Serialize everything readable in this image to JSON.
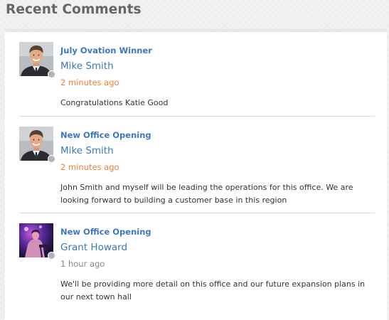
{
  "widget": {
    "title": "Recent Comments"
  },
  "colors": {
    "link": "#3d78c0",
    "recent_time": "#ef7f33",
    "old_time": "#888888",
    "status_dot": "#b3b3b3"
  },
  "comments": [
    {
      "subject": "July Ovation Winner",
      "author": "Mike Smith",
      "time": "2 minutes ago",
      "body": "Congratulations Katie Good",
      "avatar_icon": "user-avatar-mike-smith",
      "status": "offline"
    },
    {
      "subject": "New Office Opening",
      "author": "Mike Smith",
      "time": "2 minutes ago",
      "body": "John Smith and myself will be leading the operations for this office. We are looking forward to building a customer base in this region",
      "avatar_icon": "user-avatar-mike-smith",
      "status": "offline"
    },
    {
      "subject": "New Office Opening",
      "author": "Grant Howard",
      "time": "1 hour ago",
      "body": "We'll be providing more detail on this office and our future expansion plans in our next town hall",
      "avatar_icon": "user-avatar-grant-howard",
      "status": "offline"
    }
  ]
}
